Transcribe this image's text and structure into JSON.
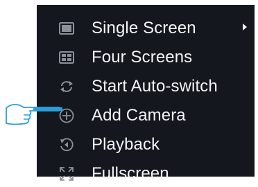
{
  "context_menu": {
    "items": [
      {
        "label": "Single Screen",
        "icon": "single-screen-icon",
        "has_submenu": true
      },
      {
        "label": "Four Screens",
        "icon": "four-screens-icon"
      },
      {
        "label": "Start Auto-switch",
        "icon": "auto-switch-icon"
      },
      {
        "label": "Add Camera",
        "icon": "add-camera-icon"
      },
      {
        "label": "Playback",
        "icon": "playback-icon"
      },
      {
        "label": "Fullscreen",
        "icon": "fullscreen-icon"
      }
    ]
  },
  "pointer": {
    "icon": "pointing-hand-icon",
    "target": "Add Camera"
  },
  "colors": {
    "menu_bg": "#14171d",
    "text": "#f3f4f6",
    "icon": "#8d9098",
    "pointer_stroke": "#2a9fd9"
  }
}
